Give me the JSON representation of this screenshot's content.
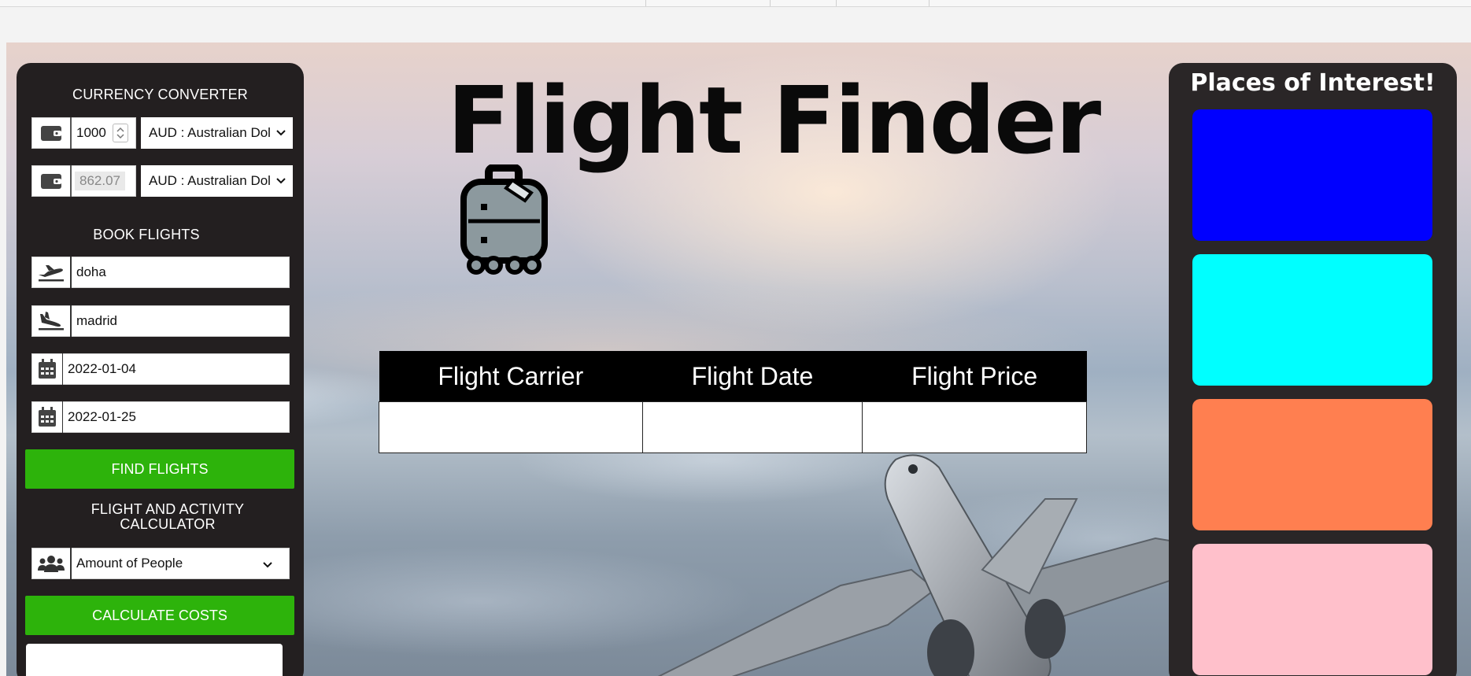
{
  "currency": {
    "title": "CURRENCY CONVERTER",
    "amount_value": "1000",
    "converted_value": "862.07",
    "from_currency": "AUD : Australian Dol",
    "to_currency": "AUD : Australian Dol"
  },
  "booking": {
    "title": "BOOK FLIGHTS",
    "from_value": "doha",
    "to_value": "madrid",
    "depart_date": "2022-01-04",
    "return_date": "2022-01-25",
    "find_button": "FIND FLIGHTS"
  },
  "calculator": {
    "title": "FLIGHT AND ACTIVITY CALCULATOR",
    "people_select": "Amount of People",
    "calc_button": "CALCULATE COSTS"
  },
  "main": {
    "title": "Flight Finder",
    "table_headers": [
      "Flight Carrier",
      "Flight Date",
      "Flight Price"
    ]
  },
  "poi": {
    "title": "Places of Interest!",
    "cards": [
      {
        "color": "#0000ff"
      },
      {
        "color": "#00ffff"
      },
      {
        "color": "#ff7f50"
      },
      {
        "color": "#ffc0cb"
      }
    ]
  }
}
